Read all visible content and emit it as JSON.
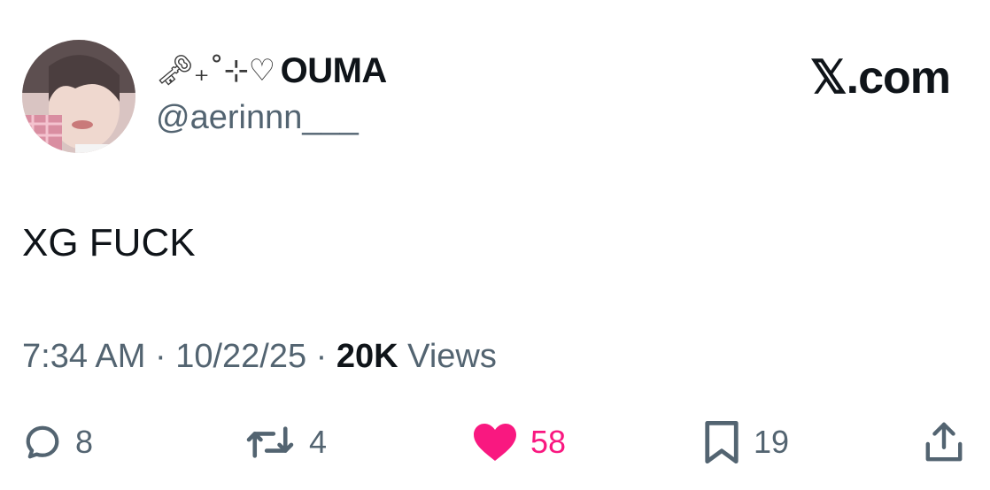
{
  "author": {
    "display_name_decoration": "🗝₊˚⊹♡",
    "display_name": "OUMA",
    "handle": "@aerinnn___",
    "avatar_icon": "user-avatar-photo"
  },
  "brand": "𝕏.com",
  "tweet": {
    "text": "XG FUCK"
  },
  "meta": {
    "time": "7:34 AM",
    "separator1": " · ",
    "date": "10/22/25",
    "separator2": " · ",
    "views_count": "20K",
    "views_label": " Views"
  },
  "actions": {
    "replies": {
      "icon": "reply-icon",
      "count": "8"
    },
    "reposts": {
      "icon": "repost-icon",
      "count": "4"
    },
    "likes": {
      "icon": "heart-icon",
      "count": "58",
      "active": true,
      "color": "#f91880"
    },
    "bookmarks": {
      "icon": "bookmark-icon",
      "count": "19"
    },
    "share": {
      "icon": "share-icon"
    }
  },
  "colors": {
    "text_primary": "#0f1419",
    "text_secondary": "#536471",
    "like_active": "#f91880"
  }
}
